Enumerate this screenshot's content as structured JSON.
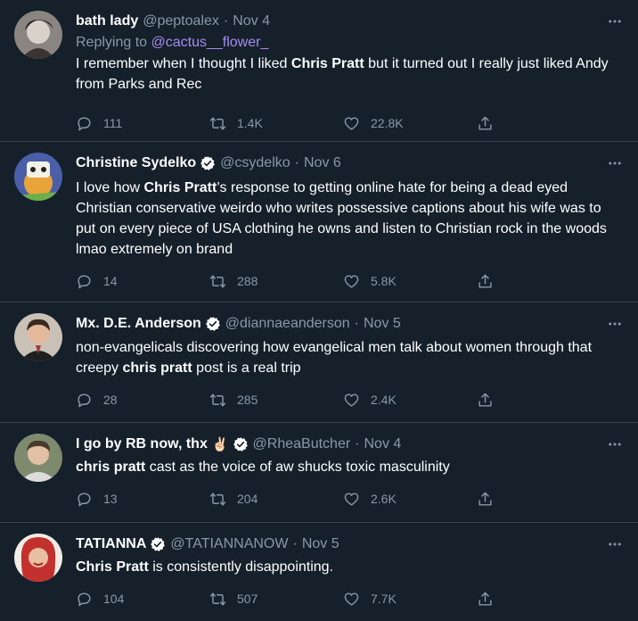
{
  "tweets": [
    {
      "name": "bath lady",
      "handle": "@peptoalex",
      "date": "Nov 4",
      "verified": false,
      "replying_label": "Replying to",
      "replying_to": "@cactus__flower_",
      "text_parts": [
        {
          "t": "I remember when I thought I liked ",
          "b": false
        },
        {
          "t": "Chris Pratt",
          "b": true
        },
        {
          "t": " but it turned out I really just liked Andy from Parks and Rec",
          "b": false
        }
      ],
      "replies": "111",
      "retweets": "1.4K",
      "likes": "22.8K",
      "avatar_color": "#8a8580"
    },
    {
      "name": "Christine Sydelko",
      "handle": "@csydelko",
      "date": "Nov 6",
      "verified": true,
      "text_parts": [
        {
          "t": "I love how ",
          "b": false
        },
        {
          "t": "Chris Pratt",
          "b": true
        },
        {
          "t": "’s response to getting online hate for being a dead eyed Christian conservative weirdo who writes possessive captions about his wife was to put on every piece of USA clothing he owns and listen to Christian rock in the woods lmao extremely on brand",
          "b": false
        }
      ],
      "replies": "14",
      "retweets": "288",
      "likes": "5.8K",
      "avatar_color": "#4a5fa8"
    },
    {
      "name": "Mx. D.E. Anderson",
      "handle": "@diannaeanderson",
      "date": "Nov 5",
      "verified": true,
      "text_parts": [
        {
          "t": "non-evangelicals discovering how evangelical men talk about women through that creepy ",
          "b": false
        },
        {
          "t": "chris pratt",
          "b": true
        },
        {
          "t": " post is a real trip",
          "b": false
        }
      ],
      "replies": "28",
      "retweets": "285",
      "likes": "2.4K",
      "avatar_color": "#c9c1b6"
    },
    {
      "name": "I go by RB now, thx",
      "name_emoji": "✌🏻",
      "handle": "@RheaButcher",
      "date": "Nov 4",
      "verified": true,
      "text_parts": [
        {
          "t": "chris pratt",
          "b": true
        },
        {
          "t": " cast as the voice of aw shucks toxic masculinity",
          "b": false
        }
      ],
      "replies": "13",
      "retweets": "204",
      "likes": "2.6K",
      "avatar_color": "#7d8a6e"
    },
    {
      "name": "TATIANNA",
      "handle": "@TATIANNANOW",
      "date": "Nov 5",
      "verified": true,
      "text_parts": [
        {
          "t": "Chris Pratt",
          "b": true
        },
        {
          "t": " is consistently disappointing.",
          "b": false
        }
      ],
      "replies": "104",
      "retweets": "507",
      "likes": "7.7K",
      "avatar_color": "#c2312e"
    }
  ],
  "colors": {
    "background": "#15202b",
    "secondary_text": "#8899a6",
    "divider": "#38444d",
    "mention": "#a58bf0",
    "verified": "#ffffff"
  },
  "icons": {
    "reply": "reply-icon",
    "retweet": "retweet-icon",
    "like": "heart-icon",
    "share": "share-icon",
    "more": "more-icon",
    "verified": "verified-badge-icon"
  }
}
